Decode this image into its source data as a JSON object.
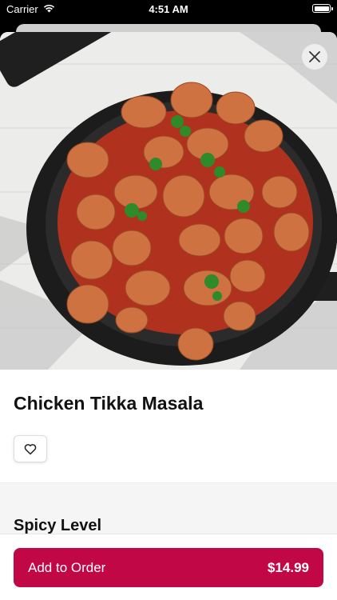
{
  "status_bar": {
    "carrier": "Carrier",
    "time": "4:51 AM"
  },
  "item": {
    "image_icon": "chicken-tikka-masala-photo",
    "title": "Chicken Tikka Masala"
  },
  "sections": {
    "spicy_level_title": "Spicy Level"
  },
  "order": {
    "add_label": "Add to Order",
    "price": "$14.99"
  },
  "colors": {
    "accent": "#C10745",
    "text": "#111111"
  }
}
